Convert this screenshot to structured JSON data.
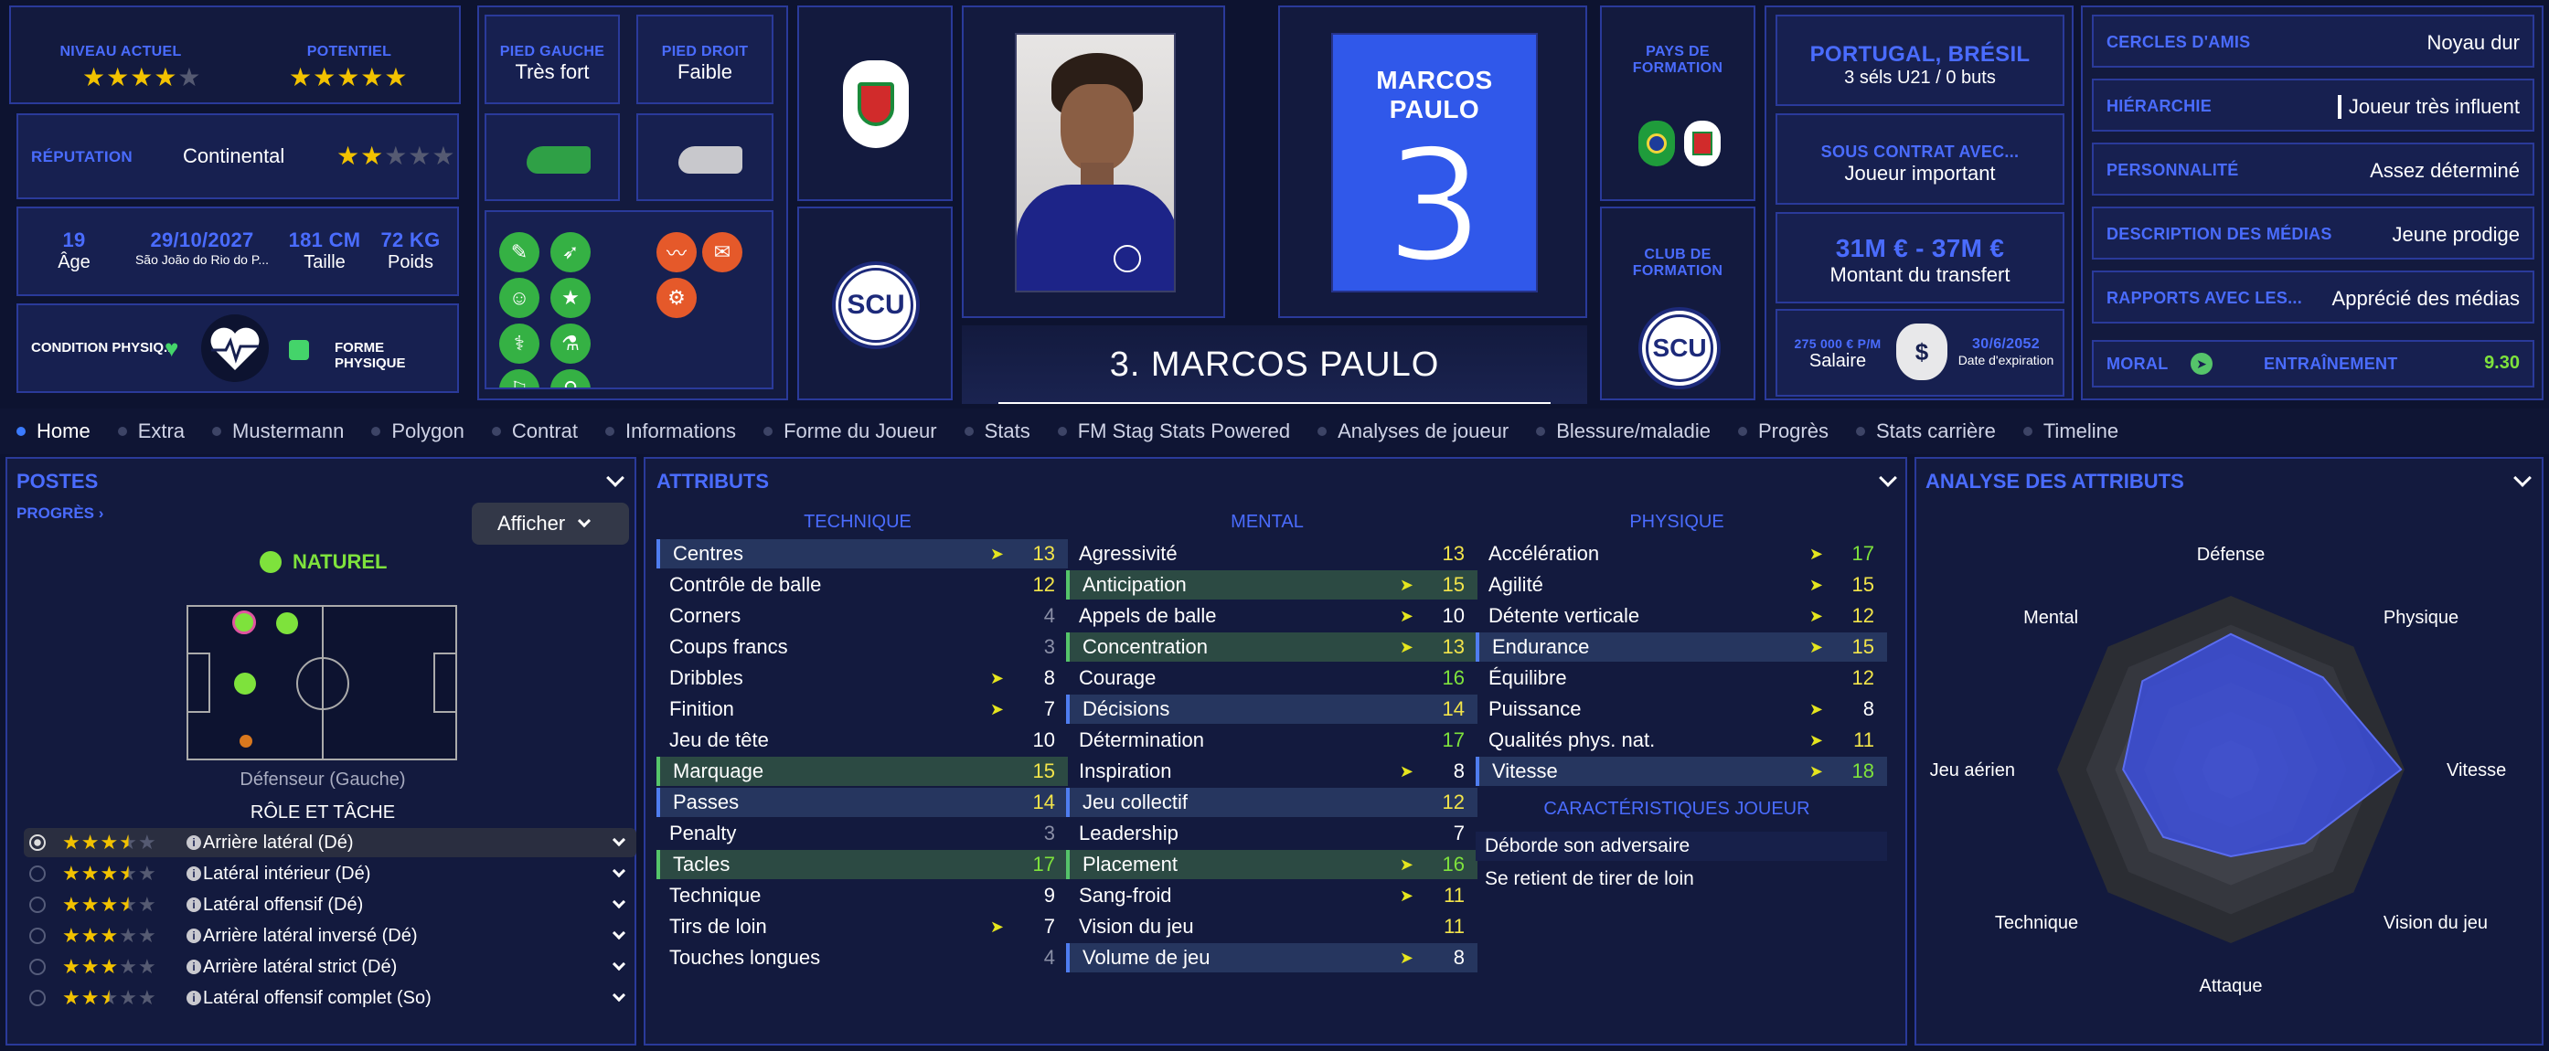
{
  "top": {
    "niveau_label": "NIVEAU ACTUEL",
    "potentiel_label": "POTENTIEL",
    "niveau_stars": 3.5,
    "potentiel_stars": 4.5,
    "reputation_label": "RÉPUTATION",
    "reputation_value": "Continental",
    "reputation_stars": 2,
    "age_value": "19",
    "age_label": "Âge",
    "birth_date": "29/10/2027",
    "birth_place": "São João do Rio do P...",
    "height_value": "181 CM",
    "height_label": "Taille",
    "weight_value": "72 KG",
    "weight_label": "Poids",
    "condition_label": "CONDITION PHYSIQ...",
    "forme_label": "FORME PHYSIQUE",
    "pied_gauche_label": "PIED GAUCHE",
    "pied_gauche_value": "Très fort",
    "pied_droit_label": "PIED DROIT",
    "pied_droit_value": "Faible",
    "player_name_card": "MARCOS PAULO",
    "player_number": "3",
    "player_title": "3. MARCOS PAULO",
    "pays_formation_label": "PAYS DE FORMATION",
    "club_formation_label": "CLUB DE FORMATION",
    "nationality": "PORTUGAL, BRÉSIL",
    "caps": "3 séls U21 / 0 buts",
    "contrat_label": "SOUS CONTRAT AVEC...",
    "contrat_value": "Joueur important",
    "transfer_value": "31M € - 37M €",
    "transfer_label": "Montant du transfert",
    "salary_value": "275 000 € P/M",
    "salary_label": "Salaire",
    "expiry_value": "30/6/2052",
    "expiry_label": "Date d'expiration",
    "club_badge": "SCU"
  },
  "right_info": [
    {
      "label": "CERCLES D'AMIS",
      "value": "Noyau dur"
    },
    {
      "label": "HIÉRARCHIE",
      "value": "Joueur très influent"
    },
    {
      "label": "PERSONNALITÉ",
      "value": "Assez déterminé"
    },
    {
      "label": "DESCRIPTION DES MÉDIAS",
      "value": "Jeune prodige"
    },
    {
      "label": "RAPPORTS AVEC LES...",
      "value": "Apprécié des médias"
    }
  ],
  "moral_label": "MORAL",
  "entrainement_label": "ENTRAÎNEMENT",
  "entrainement_value": "9.30",
  "tabs": [
    "Home",
    "Extra",
    "Mustermann",
    "Polygon",
    "Contrat",
    "Informations",
    "Forme du Joueur",
    "Stats",
    "FM Stag Stats Powered",
    "Analyses de joueur",
    "Blessure/maladie",
    "Progrès",
    "Stats carrière",
    "Timeline"
  ],
  "postes": {
    "title": "POSTES",
    "progres": "PROGRÈS",
    "afficher": "Afficher",
    "naturel": "NATUREL",
    "position_name": "Défenseur (Gauche)",
    "role_title": "RÔLE ET TÂCHE",
    "roles": [
      {
        "name": "Arrière latéral (Dé)",
        "stars": 3.5
      },
      {
        "name": "Latéral intérieur (Dé)",
        "stars": 3.5
      },
      {
        "name": "Latéral offensif (Dé)",
        "stars": 3.5
      },
      {
        "name": "Arrière latéral inversé (Dé)",
        "stars": 3
      },
      {
        "name": "Arrière latéral strict (Dé)",
        "stars": 3
      },
      {
        "name": "Latéral offensif complet (So)",
        "stars": 2.5
      }
    ]
  },
  "attributs": {
    "title": "ATTRIBUTS",
    "technique_title": "TECHNIQUE",
    "mental_title": "MENTAL",
    "physique_title": "PHYSIQUE",
    "technique": [
      {
        "name": "Centres",
        "v": "13",
        "c": "yellow",
        "arrow": true,
        "hl": "blue"
      },
      {
        "name": "Contrôle de balle",
        "v": "12",
        "c": "yellow",
        "arrow": false,
        "hl": ""
      },
      {
        "name": "Corners",
        "v": "4",
        "c": "gray",
        "arrow": false,
        "hl": ""
      },
      {
        "name": "Coups francs",
        "v": "3",
        "c": "gray",
        "arrow": false,
        "hl": ""
      },
      {
        "name": "Dribbles",
        "v": "8",
        "c": "white",
        "arrow": true,
        "hl": ""
      },
      {
        "name": "Finition",
        "v": "7",
        "c": "white",
        "arrow": true,
        "hl": ""
      },
      {
        "name": "Jeu de tête",
        "v": "10",
        "c": "white",
        "arrow": false,
        "hl": ""
      },
      {
        "name": "Marquage",
        "v": "15",
        "c": "yellow",
        "arrow": false,
        "hl": "green"
      },
      {
        "name": "Passes",
        "v": "14",
        "c": "yellow",
        "arrow": false,
        "hl": "blue"
      },
      {
        "name": "Penalty",
        "v": "3",
        "c": "gray",
        "arrow": false,
        "hl": ""
      },
      {
        "name": "Tacles",
        "v": "17",
        "c": "green",
        "arrow": false,
        "hl": "green"
      },
      {
        "name": "Technique",
        "v": "9",
        "c": "white",
        "arrow": false,
        "hl": ""
      },
      {
        "name": "Tirs de loin",
        "v": "7",
        "c": "white",
        "arrow": true,
        "hl": ""
      },
      {
        "name": "Touches longues",
        "v": "4",
        "c": "gray",
        "arrow": false,
        "hl": ""
      }
    ],
    "mental": [
      {
        "name": "Agressivité",
        "v": "13",
        "c": "yellow",
        "arrow": false,
        "hl": ""
      },
      {
        "name": "Anticipation",
        "v": "15",
        "c": "yellow",
        "arrow": true,
        "hl": "green"
      },
      {
        "name": "Appels de balle",
        "v": "10",
        "c": "white",
        "arrow": true,
        "hl": ""
      },
      {
        "name": "Concentration",
        "v": "13",
        "c": "yellow",
        "arrow": true,
        "hl": "green"
      },
      {
        "name": "Courage",
        "v": "16",
        "c": "green",
        "arrow": false,
        "hl": ""
      },
      {
        "name": "Décisions",
        "v": "14",
        "c": "yellow",
        "arrow": false,
        "hl": "blue"
      },
      {
        "name": "Détermination",
        "v": "17",
        "c": "green",
        "arrow": false,
        "hl": ""
      },
      {
        "name": "Inspiration",
        "v": "8",
        "c": "white",
        "arrow": true,
        "hl": ""
      },
      {
        "name": "Jeu collectif",
        "v": "12",
        "c": "yellow",
        "arrow": false,
        "hl": "blue"
      },
      {
        "name": "Leadership",
        "v": "7",
        "c": "white",
        "arrow": false,
        "hl": ""
      },
      {
        "name": "Placement",
        "v": "16",
        "c": "green",
        "arrow": true,
        "hl": "green"
      },
      {
        "name": "Sang-froid",
        "v": "11",
        "c": "yellow",
        "arrow": true,
        "hl": ""
      },
      {
        "name": "Vision du jeu",
        "v": "11",
        "c": "yellow",
        "arrow": false,
        "hl": ""
      },
      {
        "name": "Volume de jeu",
        "v": "8",
        "c": "white",
        "arrow": true,
        "hl": "blue"
      }
    ],
    "physique": [
      {
        "name": "Accélération",
        "v": "17",
        "c": "green",
        "arrow": true,
        "hl": ""
      },
      {
        "name": "Agilité",
        "v": "15",
        "c": "yellow",
        "arrow": true,
        "hl": ""
      },
      {
        "name": "Détente verticale",
        "v": "12",
        "c": "yellow",
        "arrow": true,
        "hl": ""
      },
      {
        "name": "Endurance",
        "v": "15",
        "c": "yellow",
        "arrow": true,
        "hl": "blue"
      },
      {
        "name": "Équilibre",
        "v": "12",
        "c": "yellow",
        "arrow": false,
        "hl": ""
      },
      {
        "name": "Puissance",
        "v": "8",
        "c": "white",
        "arrow": true,
        "hl": ""
      },
      {
        "name": "Qualités phys. nat.",
        "v": "11",
        "c": "yellow",
        "arrow": true,
        "hl": ""
      },
      {
        "name": "Vitesse",
        "v": "18",
        "c": "green",
        "arrow": true,
        "hl": "blue"
      }
    ],
    "carac_title": "CARACTÉRISTIQUES JOUEUR",
    "carac": [
      "Déborde son adversaire",
      "Se retient de tirer de loin"
    ]
  },
  "analyse": {
    "title": "ANALYSE DES ATTRIBUTS",
    "axes": [
      "Défense",
      "Physique",
      "Vitesse",
      "Vision du jeu",
      "Attaque",
      "Technique",
      "Jeu aérien",
      "Mental"
    ],
    "values": [
      0.78,
      0.75,
      0.98,
      0.6,
      0.5,
      0.55,
      0.62,
      0.72
    ]
  }
}
